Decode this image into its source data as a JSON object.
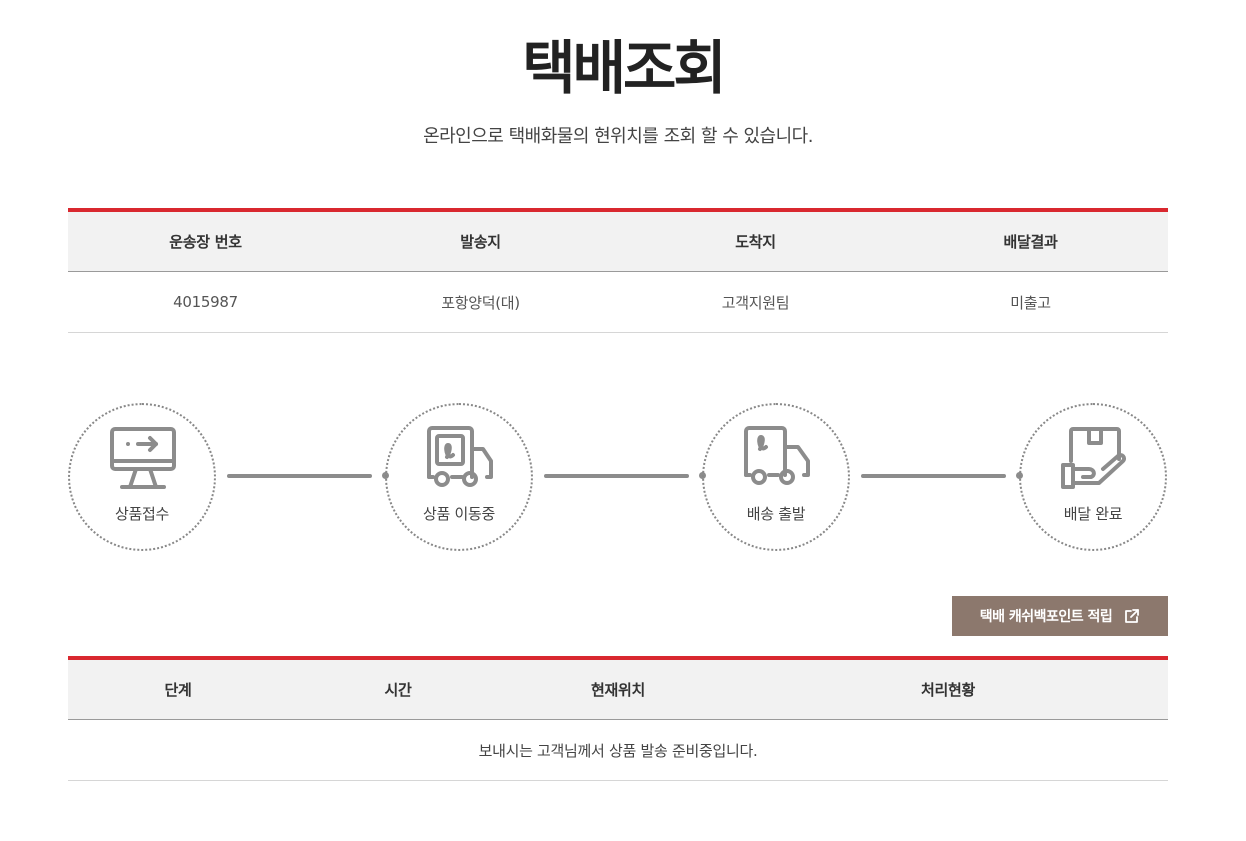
{
  "header": {
    "title": "택배조회",
    "subtitle": "온라인으로 택배화물의 현위치를 조회 할 수 있습니다."
  },
  "summary": {
    "columns": [
      "운송장 번호",
      "발송지",
      "도착지",
      "배달결과"
    ],
    "row": [
      "4015987",
      "포항양덕(대)",
      "고객지원팀",
      "미출고"
    ]
  },
  "steps": [
    {
      "label": "상품접수",
      "icon": "monitor-icon"
    },
    {
      "label": "상품 이동중",
      "icon": "truck-icon"
    },
    {
      "label": "배송 출발",
      "icon": "truck-icon"
    },
    {
      "label": "배달 완료",
      "icon": "package-hand-icon"
    }
  ],
  "cashback": {
    "label": "택배 캐쉬백포인트 적립",
    "icon": "external-link-icon"
  },
  "history": {
    "columns": [
      "단계",
      "시간",
      "현재위치",
      "처리현황"
    ],
    "message": "보내시는 고객님께서 상품 발송 준비중입니다."
  },
  "colors": {
    "accent": "#d9282f",
    "button": "#8c786d",
    "icon": "#8c8c8c"
  }
}
